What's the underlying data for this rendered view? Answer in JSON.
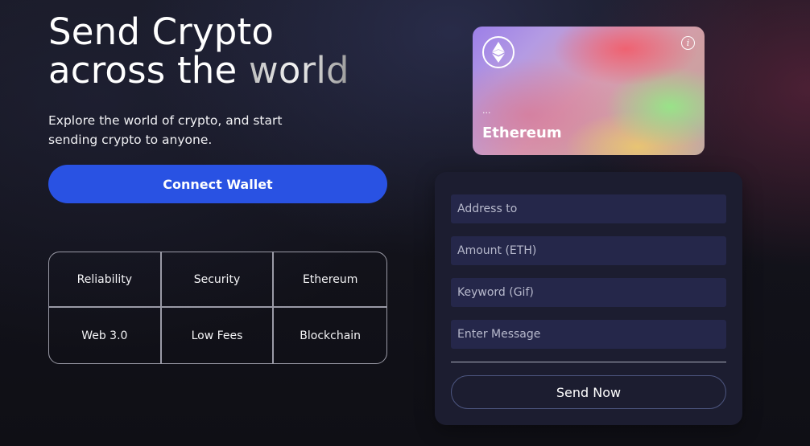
{
  "hero": {
    "title_line1": "Send Crypto",
    "title_line2_plain": "across the ",
    "title_line2_highlight": "world",
    "subtitle": "Explore the world of crypto, and start sending crypto to anyone."
  },
  "connect_button": {
    "label": "Connect Wallet",
    "color": "#2952e3"
  },
  "features": [
    "Reliability",
    "Security",
    "Ethereum",
    "Web 3.0",
    "Low Fees",
    "Blockchain"
  ],
  "card": {
    "logo_icon": "ethereum-icon",
    "info_icon": "info-icon",
    "info_glyph": "i",
    "address": "...",
    "network": "Ethereum"
  },
  "form": {
    "address_placeholder": "Address to",
    "amount_placeholder": "Amount (ETH)",
    "keyword_placeholder": "Keyword (Gif)",
    "message_placeholder": "Enter Message",
    "send_label": "Send Now",
    "background": "#1c1d30",
    "field_background": "#25274a"
  }
}
